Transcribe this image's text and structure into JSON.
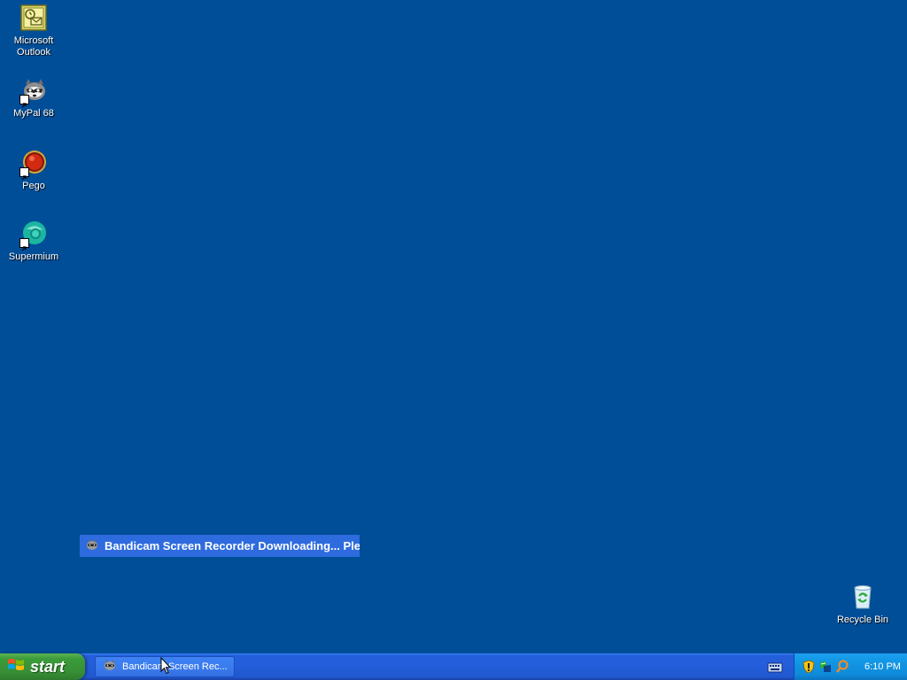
{
  "desktop": {
    "icons": [
      {
        "label": "Microsoft Outlook"
      },
      {
        "label": "MyPal 68"
      },
      {
        "label": "Pego"
      },
      {
        "label": "Supermium"
      },
      {
        "label": "Recycle Bin"
      }
    ]
  },
  "drag_window": {
    "title": "Bandicam Screen Recorder Downloading... Plea"
  },
  "taskbar": {
    "start_label": "start",
    "task_button_label": "Bandicam Screen Rec...",
    "clock": "6:10 PM"
  },
  "colors": {
    "desktop_bg": "#004e98",
    "taskbar_blue": "#245edb",
    "start_green": "#3c9c3a",
    "systray_blue": "#0e8ad9"
  }
}
